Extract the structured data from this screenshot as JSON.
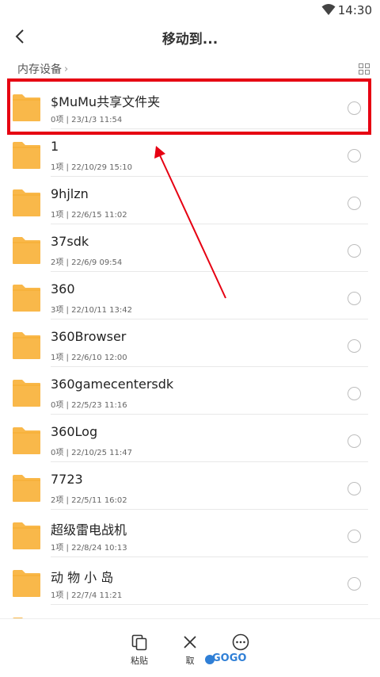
{
  "status": {
    "time": "14:30"
  },
  "header": {
    "title": "移动到..."
  },
  "breadcrumb": {
    "label": "内存设备"
  },
  "files": [
    {
      "name": "$MuMu共享文件夹",
      "meta": "0项 | 23/1/3 11:54"
    },
    {
      "name": "1",
      "meta": "1项 | 22/10/29 15:10"
    },
    {
      "name": "9hjlzn",
      "meta": "1项 | 22/6/15 11:02"
    },
    {
      "name": "37sdk",
      "meta": "2项 | 22/6/9 09:54"
    },
    {
      "name": "360",
      "meta": "3项 | 22/10/11 13:42"
    },
    {
      "name": "360Browser",
      "meta": "1项 | 22/6/10 12:00"
    },
    {
      "name": "360gamecentersdk",
      "meta": "0项 | 22/5/23 11:16"
    },
    {
      "name": "360Log",
      "meta": "0项 | 22/10/25 11:47"
    },
    {
      "name": "7723",
      "meta": "2项 | 22/5/11 16:02"
    },
    {
      "name": "超级雷电战机",
      "meta": "1项 | 22/8/24 10:13"
    },
    {
      "name": "动 物 小 岛",
      "meta": "1项 | 22/7/4 11:21"
    }
  ],
  "actions": {
    "paste": "粘贴",
    "cancel": "取",
    "more": ""
  },
  "watermark": {
    "text": "GOGO"
  },
  "colors": {
    "folder": "#f9b84a",
    "highlight": "#e60012",
    "accent": "#2f7fd6"
  },
  "icons": [
    "wifi-icon",
    "back-icon",
    "grid-view-icon",
    "folder-icon",
    "radio-icon",
    "paste-icon",
    "close-icon",
    "more-icon"
  ]
}
